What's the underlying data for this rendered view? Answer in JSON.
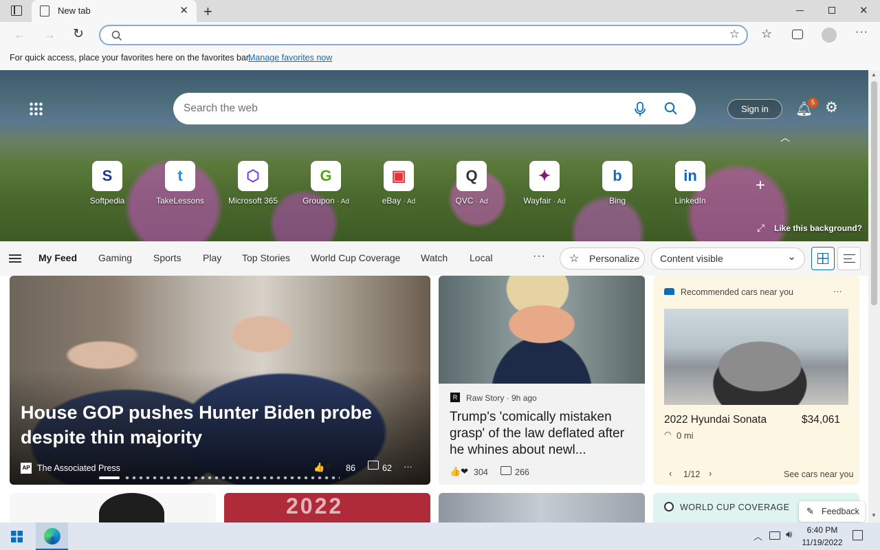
{
  "browser": {
    "tab_title": "New tab",
    "omnibox_value": "",
    "favorites_text": "For quick access, place your favorites here on the favorites bar.",
    "favorites_link": "Manage favorites now"
  },
  "hero": {
    "search_placeholder": "Search the web",
    "sign_in": "Sign in",
    "notification_count": "5",
    "like_background": "Like this background?",
    "tiles": [
      {
        "label": "Softpedia",
        "ad": "",
        "glyph": "S",
        "color": "#1d3b8c"
      },
      {
        "label": "TakeLessons",
        "ad": "",
        "glyph": "t",
        "color": "#2b8bd8"
      },
      {
        "label": "Microsoft 365",
        "ad": "",
        "glyph": "⬡",
        "color": "#7b3fe4"
      },
      {
        "label": "Groupon",
        "ad": "· Ad",
        "glyph": "G",
        "color": "#53a318"
      },
      {
        "label": "eBay",
        "ad": "· Ad",
        "glyph": "▣",
        "color": "#e53238"
      },
      {
        "label": "QVC",
        "ad": "· Ad",
        "glyph": "Q",
        "color": "#333333"
      },
      {
        "label": "Wayfair",
        "ad": "· Ad",
        "glyph": "✦",
        "color": "#7f187f"
      },
      {
        "label": "Bing",
        "ad": "",
        "glyph": "b",
        "color": "#0f6cbd"
      },
      {
        "label": "LinkedIn",
        "ad": "",
        "glyph": "in",
        "color": "#0a66c2"
      }
    ]
  },
  "nav": {
    "items": [
      "My Feed",
      "Gaming",
      "Sports",
      "Play",
      "Top Stories",
      "World Cup Coverage",
      "Watch",
      "Local"
    ],
    "personalize": "Personalize",
    "content_visible": "Content visible"
  },
  "main_story": {
    "headline": "House GOP pushes Hunter Biden probe despite thin majority",
    "source": "The Associated Press",
    "reactions": "86",
    "comments": "62"
  },
  "second_story": {
    "source": "Raw Story · 9h ago",
    "headline": "Trump's 'comically mistaken grasp' of the law deflated after he whines about newl...",
    "reactions": "304",
    "comments": "266"
  },
  "car_card": {
    "header": "Recommended cars near you",
    "model": "2022 Hyundai Sonata",
    "price": "$34,061",
    "distance": "0 mi",
    "pager": "1/12",
    "link": "See cars near you"
  },
  "bottom": {
    "world_cup": "WORLD CUP COVERAGE",
    "year_text": "2022",
    "feedback": "Feedback"
  },
  "taskbar": {
    "time": "6:40 PM",
    "date": "11/19/2022"
  }
}
